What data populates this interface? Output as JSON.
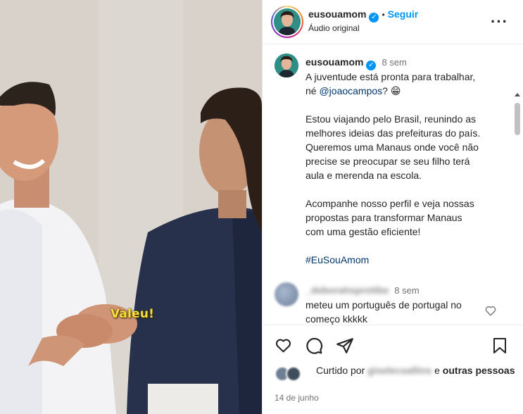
{
  "media": {
    "caption_overlay": "Valeu!"
  },
  "header": {
    "username": "eusouamom",
    "separator": "•",
    "follow_label": "Seguir",
    "audio_label": "Áudio original",
    "more_icon": "more-horizontal-icon"
  },
  "caption": {
    "username": "eusouamom",
    "time": "8 sem",
    "line1": "A juventude está pronta para trabalhar,",
    "line2_pre": "né ",
    "mention": "@joaocampos",
    "line2_post": "? 😁",
    "paragraph2": "Estou viajando pelo Brasil, reunindo as\nmelhores ideias das prefeituras do país.\nQueremos uma Manaus onde você não\nprecise se preocupar se seu filho terá\naula e merenda na escola.",
    "paragraph3": "Acompanhe nosso perfil e veja nossas\npropostas para transformar Manaus\ncom uma gestão eficiente!",
    "hashtag": "#EuSouAmom"
  },
  "comment": {
    "username": "_deborahsprotibe",
    "time": "8 sem",
    "text": "meteu um português de portugal no começo kkkkk"
  },
  "actions": {
    "like_icon": "heart-icon",
    "comment_icon": "comment-icon",
    "share_icon": "share-icon",
    "save_icon": "bookmark-icon"
  },
  "likes": {
    "prefix": "Curtido por",
    "liker": "giselecsallins",
    "conjunction": "e",
    "others": "outras pessoas"
  },
  "date": "14 de junho",
  "colors": {
    "accent": "#0095f6",
    "link": "#00376b",
    "overlay_text": "#f7e03a"
  }
}
